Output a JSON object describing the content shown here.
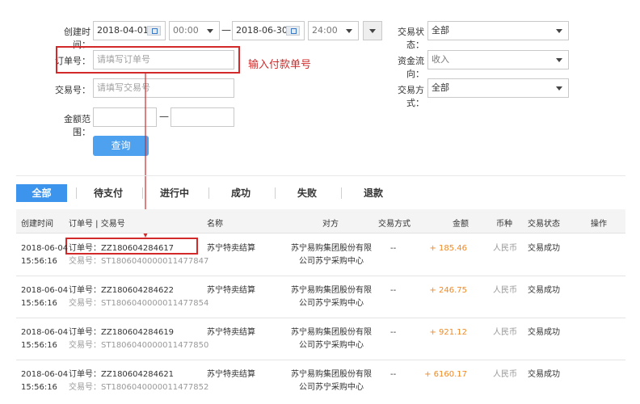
{
  "filters": {
    "created_label": "创建时间：",
    "start_date": "2018-04-01",
    "start_time": "00:00",
    "range_dash": "—",
    "end_date": "2018-06-30",
    "end_time": "24:00",
    "status_label": "交易状态：",
    "status_value": "全部",
    "order_label": "订单号：",
    "order_placeholder": "请填写订单号",
    "flow_label": "资金流向：",
    "flow_value": "收入",
    "trade_label": "交易号：",
    "trade_placeholder": "请填写交易号",
    "method_label": "交易方式：",
    "method_value": "全部",
    "amount_label": "金额范围：",
    "amount_dash": "—",
    "search_button": "查询"
  },
  "annotation": {
    "note": "输入付款单号",
    "color": "#d22a2a"
  },
  "tabs": [
    "全部",
    "待支付",
    "进行中",
    "成功",
    "失败",
    "退款"
  ],
  "table": {
    "headers": {
      "created": "创建时间",
      "order_trade": "订单号 | 交易号",
      "name": "名称",
      "counterparty": "对方",
      "method": "交易方式",
      "amount": "金额",
      "currency": "币种",
      "status": "交易状态",
      "action": "操作"
    },
    "rows": [
      {
        "date": "2018-06-04",
        "time": "15:56:16",
        "order": "订单号：ZZ180604284617",
        "trade": "交易号：ST1806040000011477847",
        "name": "苏宁特卖结算",
        "party_1": "苏宁易购集团股份有限",
        "party_2": "公司苏宁采购中心",
        "method": "--",
        "amount": "+ 185.46",
        "currency": "人民币",
        "status": "交易成功"
      },
      {
        "date": "2018-06-04",
        "time": "15:56:16",
        "order": "订单号：ZZ180604284622",
        "trade": "交易号：ST1806040000011477854",
        "name": "苏宁特卖结算",
        "party_1": "苏宁易购集团股份有限",
        "party_2": "公司苏宁采购中心",
        "method": "--",
        "amount": "+ 246.75",
        "currency": "人民币",
        "status": "交易成功"
      },
      {
        "date": "2018-06-04",
        "time": "15:56:16",
        "order": "订单号：ZZ180604284619",
        "trade": "交易号：ST1806040000011477850",
        "name": "苏宁特卖结算",
        "party_1": "苏宁易购集团股份有限",
        "party_2": "公司苏宁采购中心",
        "method": "--",
        "amount": "+ 921.12",
        "currency": "人民币",
        "status": "交易成功"
      },
      {
        "date": "2018-06-04",
        "time": "15:56:16",
        "order": "订单号：ZZ180604284621",
        "trade": "交易号：ST1806040000011477852",
        "name": "苏宁特卖结算",
        "party_1": "苏宁易购集团股份有限",
        "party_2": "公司苏宁采购中心",
        "method": "--",
        "amount": "+ 6160.17",
        "currency": "人民币",
        "status": "交易成功"
      }
    ]
  },
  "colors": {
    "accent": "#3d94ec",
    "button": "#4da1ef",
    "amount": "#f08a24",
    "highlight": "#d22a2a"
  }
}
